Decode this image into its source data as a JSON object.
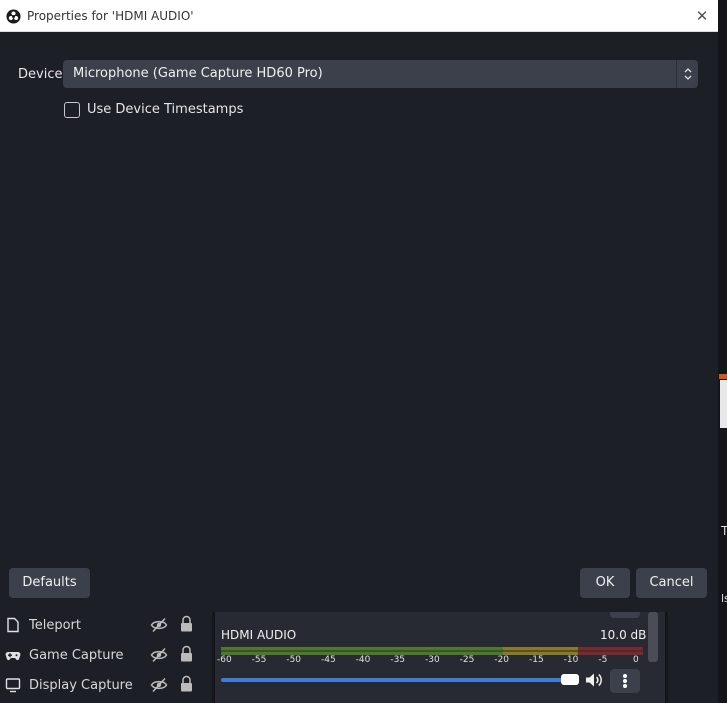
{
  "dialog": {
    "title": "Properties for 'HDMI AUDIO'",
    "close_glyph": "✕",
    "device_label": "Device",
    "device_value": "Microphone (Game Capture HD60 Pro)",
    "timestamps_label": "Use Device Timestamps",
    "timestamps_checked": false,
    "defaults_label": "Defaults",
    "ok_label": "OK",
    "cancel_label": "Cancel"
  },
  "sources": [
    {
      "name": "Teleport",
      "icon": "file-icon"
    },
    {
      "name": "Game Capture",
      "icon": "gamepad-icon"
    },
    {
      "name": "Display Capture",
      "icon": "monitor-icon"
    }
  ],
  "mixer": {
    "channel_name": "HDMI AUDIO",
    "gain": "10.0 dB",
    "scale": [
      "-60",
      "-55",
      "-50",
      "-45",
      "-40",
      "-35",
      "-30",
      "-25",
      "-20",
      "-15",
      "-10",
      "-5",
      "0"
    ],
    "volume_level": 1.0,
    "meter_colors": {
      "green": "#4c7a2a",
      "yellow": "#8a7a22",
      "red": "#7a2a2a"
    }
  },
  "colors": {
    "accent": "#3d7dd6",
    "dialog_bg": "#1d1f26",
    "button_bg": "#3c404b"
  }
}
